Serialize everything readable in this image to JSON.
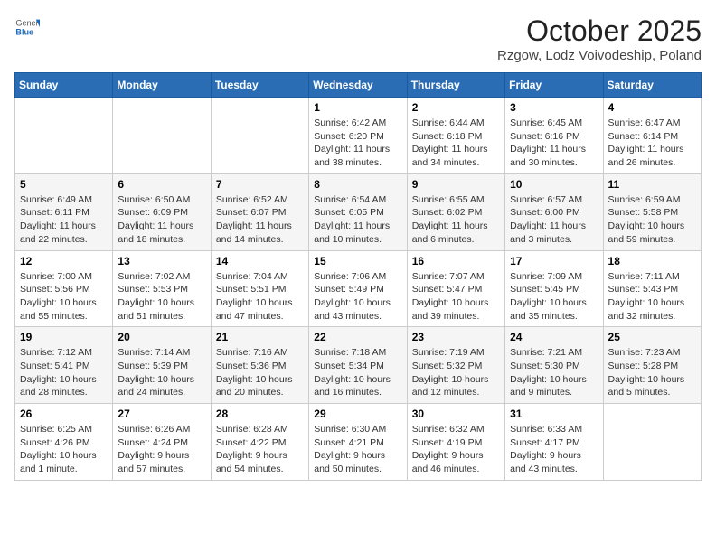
{
  "header": {
    "logo": {
      "line1": "General",
      "line2": "Blue"
    },
    "title": "October 2025",
    "location": "Rzgow, Lodz Voivodeship, Poland"
  },
  "weekdays": [
    "Sunday",
    "Monday",
    "Tuesday",
    "Wednesday",
    "Thursday",
    "Friday",
    "Saturday"
  ],
  "weeks": [
    [
      {
        "day": "",
        "content": ""
      },
      {
        "day": "",
        "content": ""
      },
      {
        "day": "",
        "content": ""
      },
      {
        "day": "1",
        "content": "Sunrise: 6:42 AM\nSunset: 6:20 PM\nDaylight: 11 hours and 38 minutes."
      },
      {
        "day": "2",
        "content": "Sunrise: 6:44 AM\nSunset: 6:18 PM\nDaylight: 11 hours and 34 minutes."
      },
      {
        "day": "3",
        "content": "Sunrise: 6:45 AM\nSunset: 6:16 PM\nDaylight: 11 hours and 30 minutes."
      },
      {
        "day": "4",
        "content": "Sunrise: 6:47 AM\nSunset: 6:14 PM\nDaylight: 11 hours and 26 minutes."
      }
    ],
    [
      {
        "day": "5",
        "content": "Sunrise: 6:49 AM\nSunset: 6:11 PM\nDaylight: 11 hours and 22 minutes."
      },
      {
        "day": "6",
        "content": "Sunrise: 6:50 AM\nSunset: 6:09 PM\nDaylight: 11 hours and 18 minutes."
      },
      {
        "day": "7",
        "content": "Sunrise: 6:52 AM\nSunset: 6:07 PM\nDaylight: 11 hours and 14 minutes."
      },
      {
        "day": "8",
        "content": "Sunrise: 6:54 AM\nSunset: 6:05 PM\nDaylight: 11 hours and 10 minutes."
      },
      {
        "day": "9",
        "content": "Sunrise: 6:55 AM\nSunset: 6:02 PM\nDaylight: 11 hours and 6 minutes."
      },
      {
        "day": "10",
        "content": "Sunrise: 6:57 AM\nSunset: 6:00 PM\nDaylight: 11 hours and 3 minutes."
      },
      {
        "day": "11",
        "content": "Sunrise: 6:59 AM\nSunset: 5:58 PM\nDaylight: 10 hours and 59 minutes."
      }
    ],
    [
      {
        "day": "12",
        "content": "Sunrise: 7:00 AM\nSunset: 5:56 PM\nDaylight: 10 hours and 55 minutes."
      },
      {
        "day": "13",
        "content": "Sunrise: 7:02 AM\nSunset: 5:53 PM\nDaylight: 10 hours and 51 minutes."
      },
      {
        "day": "14",
        "content": "Sunrise: 7:04 AM\nSunset: 5:51 PM\nDaylight: 10 hours and 47 minutes."
      },
      {
        "day": "15",
        "content": "Sunrise: 7:06 AM\nSunset: 5:49 PM\nDaylight: 10 hours and 43 minutes."
      },
      {
        "day": "16",
        "content": "Sunrise: 7:07 AM\nSunset: 5:47 PM\nDaylight: 10 hours and 39 minutes."
      },
      {
        "day": "17",
        "content": "Sunrise: 7:09 AM\nSunset: 5:45 PM\nDaylight: 10 hours and 35 minutes."
      },
      {
        "day": "18",
        "content": "Sunrise: 7:11 AM\nSunset: 5:43 PM\nDaylight: 10 hours and 32 minutes."
      }
    ],
    [
      {
        "day": "19",
        "content": "Sunrise: 7:12 AM\nSunset: 5:41 PM\nDaylight: 10 hours and 28 minutes."
      },
      {
        "day": "20",
        "content": "Sunrise: 7:14 AM\nSunset: 5:39 PM\nDaylight: 10 hours and 24 minutes."
      },
      {
        "day": "21",
        "content": "Sunrise: 7:16 AM\nSunset: 5:36 PM\nDaylight: 10 hours and 20 minutes."
      },
      {
        "day": "22",
        "content": "Sunrise: 7:18 AM\nSunset: 5:34 PM\nDaylight: 10 hours and 16 minutes."
      },
      {
        "day": "23",
        "content": "Sunrise: 7:19 AM\nSunset: 5:32 PM\nDaylight: 10 hours and 12 minutes."
      },
      {
        "day": "24",
        "content": "Sunrise: 7:21 AM\nSunset: 5:30 PM\nDaylight: 10 hours and 9 minutes."
      },
      {
        "day": "25",
        "content": "Sunrise: 7:23 AM\nSunset: 5:28 PM\nDaylight: 10 hours and 5 minutes."
      }
    ],
    [
      {
        "day": "26",
        "content": "Sunrise: 6:25 AM\nSunset: 4:26 PM\nDaylight: 10 hours and 1 minute."
      },
      {
        "day": "27",
        "content": "Sunrise: 6:26 AM\nSunset: 4:24 PM\nDaylight: 9 hours and 57 minutes."
      },
      {
        "day": "28",
        "content": "Sunrise: 6:28 AM\nSunset: 4:22 PM\nDaylight: 9 hours and 54 minutes."
      },
      {
        "day": "29",
        "content": "Sunrise: 6:30 AM\nSunset: 4:21 PM\nDaylight: 9 hours and 50 minutes."
      },
      {
        "day": "30",
        "content": "Sunrise: 6:32 AM\nSunset: 4:19 PM\nDaylight: 9 hours and 46 minutes."
      },
      {
        "day": "31",
        "content": "Sunrise: 6:33 AM\nSunset: 4:17 PM\nDaylight: 9 hours and 43 minutes."
      },
      {
        "day": "",
        "content": ""
      }
    ]
  ]
}
